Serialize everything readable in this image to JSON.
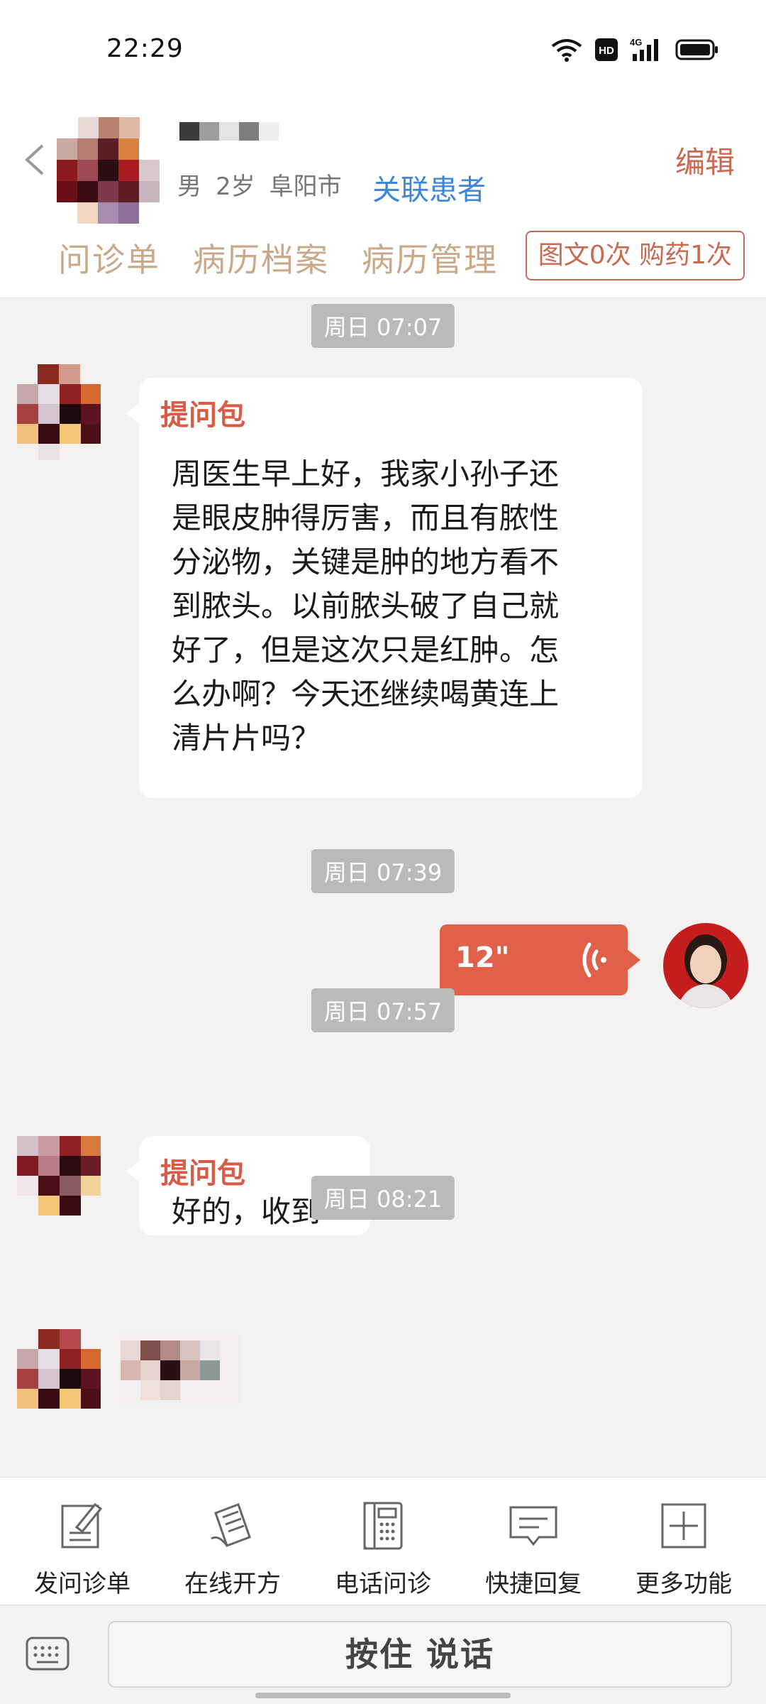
{
  "status_bar": {
    "time": "22:29",
    "hd_badge": "HD",
    "network": "4G"
  },
  "header": {
    "gender": "男",
    "age": "2岁",
    "city": "阜阳市",
    "link_patient": "关联患者",
    "edit": "编辑",
    "tabs": [
      "问诊单",
      "病历档案",
      "病历管理"
    ],
    "quota": "图文0次 购药1次"
  },
  "messages": [
    {
      "time": "周日 07:07",
      "tag": "提问包",
      "lines": [
        "周医生早上好，我家小孙子还",
        "是眼皮肿得厉害，而且有脓性",
        "分泌物，关键是肿的地方看不",
        "到脓头。以前脓头破了自己就",
        "好了，但是这次只是红肿。怎",
        "么办啊？今天还继续喝黄连上",
        "清片片吗？"
      ]
    },
    {
      "time": "周日 07:39",
      "voice_duration": "12\""
    },
    {
      "time": "周日 07:57",
      "tag": "提问包",
      "lines": [
        "好的，收到"
      ]
    },
    {
      "time": "周日 08:21"
    }
  ],
  "functions": [
    "发问诊单",
    "在线开方",
    "电话问诊",
    "快捷回复",
    "更多功能"
  ],
  "input": {
    "hold_to_talk": "按住 说话"
  }
}
